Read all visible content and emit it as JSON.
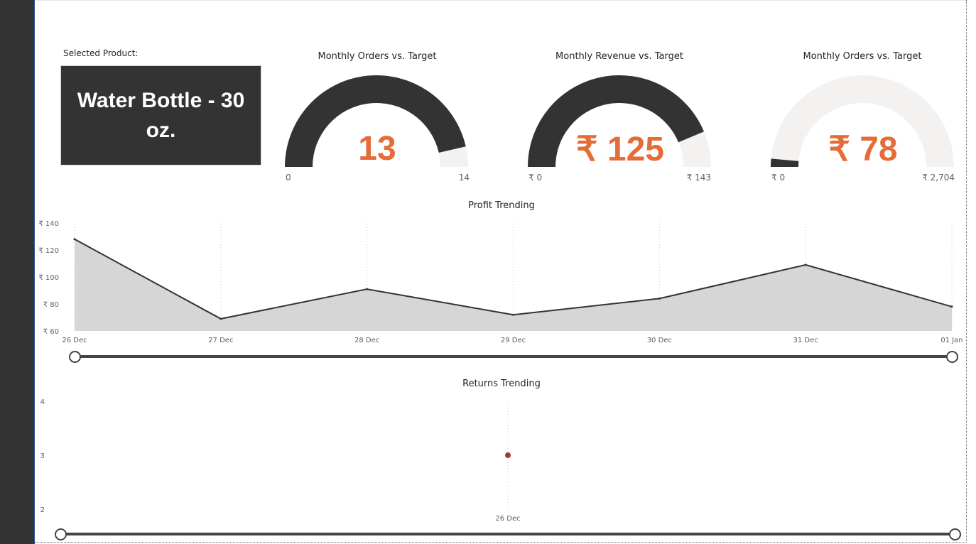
{
  "selected_product": {
    "label": "Selected Product:",
    "value": "Water Bottle - 30 oz."
  },
  "gauges": [
    {
      "title": "Monthly Orders vs. Target",
      "value_text": "13",
      "value": 13,
      "min_label": "0",
      "max_label": "14",
      "min": 0,
      "max": 14
    },
    {
      "title": "Monthly Revenue vs. Target",
      "value_text": "₹ 125",
      "value": 125,
      "min_label": "₹ 0",
      "max_label": "₹ 143",
      "min": 0,
      "max": 143
    },
    {
      "title": "Monthly Orders vs. Target",
      "value_text": "₹ 78",
      "value": 78,
      "min_label": "₹ 0",
      "max_label": "₹ 2,704",
      "min": 0,
      "max": 2704
    }
  ],
  "colors": {
    "gauge_fill": "#333333",
    "gauge_track": "#f3f2f1",
    "value_text": "#e66c37",
    "area_fill": "#d6d6d6",
    "line": "#333333",
    "returns_point": "#a4373a"
  },
  "chart_data": [
    {
      "type": "area",
      "title": "Profit Trending",
      "x": [
        "26 Dec",
        "27 Dec",
        "28 Dec",
        "29 Dec",
        "30 Dec",
        "31 Dec",
        "01 Jan"
      ],
      "values": [
        128,
        69,
        91,
        72,
        84,
        109,
        78
      ],
      "ylim": [
        60,
        140
      ],
      "yticks": [
        60,
        80,
        100,
        120,
        140
      ],
      "ytick_labels": [
        "₹ 60",
        "₹ 80",
        "₹ 100",
        "₹ 120",
        "₹ 140"
      ],
      "grid": "vertical dotted"
    },
    {
      "type": "scatter",
      "title": "Returns Trending",
      "x": [
        "26 Dec"
      ],
      "values": [
        3
      ],
      "ylim": [
        2,
        4
      ],
      "yticks": [
        2,
        3,
        4
      ],
      "ytick_labels": [
        "2",
        "3",
        "4"
      ],
      "grid": "vertical dotted"
    }
  ]
}
